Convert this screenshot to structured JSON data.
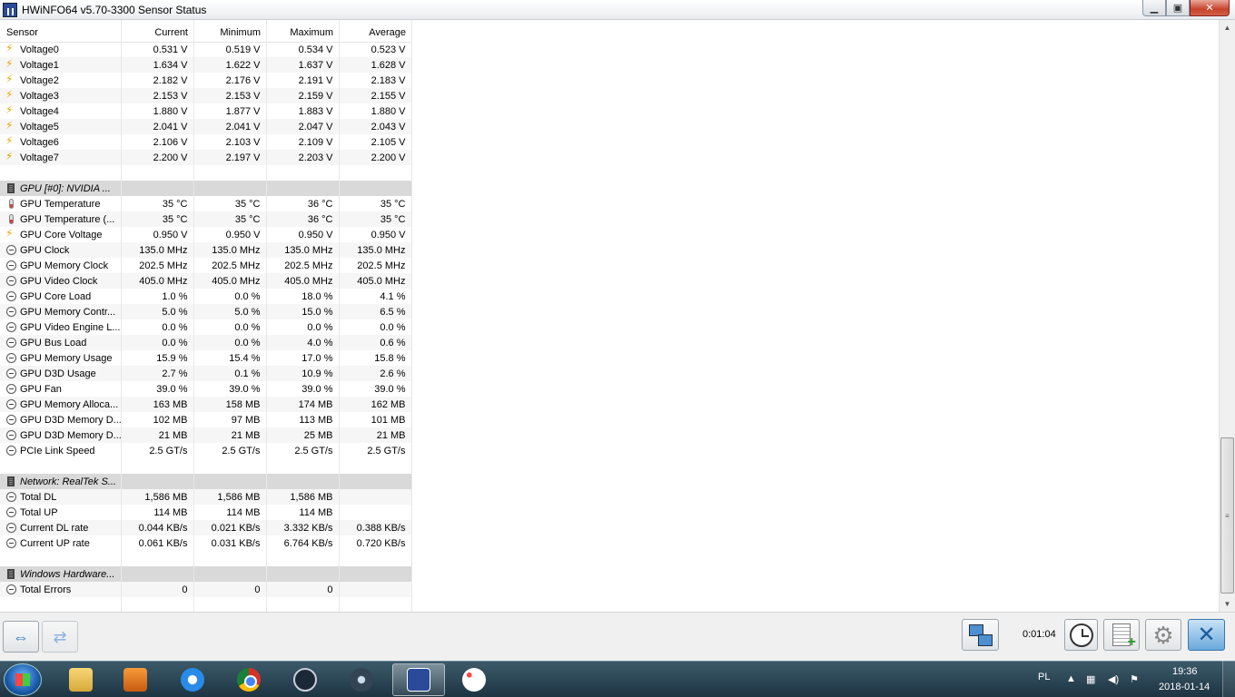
{
  "window": {
    "title": "HWiNFO64 v5.70-3300 Sensor Status"
  },
  "columns": [
    "Sensor",
    "Current",
    "Minimum",
    "Maximum",
    "Average"
  ],
  "rows": [
    {
      "type": "data",
      "icon": "bolt",
      "name": "Voltage0",
      "cur": "0.531 V",
      "min": "0.519 V",
      "max": "0.534 V",
      "avg": "0.523 V"
    },
    {
      "type": "data",
      "icon": "bolt",
      "name": "Voltage1",
      "cur": "1.634 V",
      "min": "1.622 V",
      "max": "1.637 V",
      "avg": "1.628 V"
    },
    {
      "type": "data",
      "icon": "bolt",
      "name": "Voltage2",
      "cur": "2.182 V",
      "min": "2.176 V",
      "max": "2.191 V",
      "avg": "2.183 V"
    },
    {
      "type": "data",
      "icon": "bolt",
      "name": "Voltage3",
      "cur": "2.153 V",
      "min": "2.153 V",
      "max": "2.159 V",
      "avg": "2.155 V"
    },
    {
      "type": "data",
      "icon": "bolt",
      "name": "Voltage4",
      "cur": "1.880 V",
      "min": "1.877 V",
      "max": "1.883 V",
      "avg": "1.880 V"
    },
    {
      "type": "data",
      "icon": "bolt",
      "name": "Voltage5",
      "cur": "2.041 V",
      "min": "2.041 V",
      "max": "2.047 V",
      "avg": "2.043 V"
    },
    {
      "type": "data",
      "icon": "bolt",
      "name": "Voltage6",
      "cur": "2.106 V",
      "min": "2.103 V",
      "max": "2.109 V",
      "avg": "2.105 V"
    },
    {
      "type": "data",
      "icon": "bolt",
      "name": "Voltage7",
      "cur": "2.200 V",
      "min": "2.197 V",
      "max": "2.203 V",
      "avg": "2.200 V"
    },
    {
      "type": "gap"
    },
    {
      "type": "group",
      "name": "GPU [#0]: NVIDIA ..."
    },
    {
      "type": "data",
      "icon": "therm",
      "name": "GPU Temperature",
      "cur": "35 °C",
      "min": "35 °C",
      "max": "36 °C",
      "avg": "35 °C"
    },
    {
      "type": "data",
      "icon": "therm",
      "name": "GPU Temperature (...",
      "cur": "35 °C",
      "min": "35 °C",
      "max": "36 °C",
      "avg": "35 °C"
    },
    {
      "type": "data",
      "icon": "bolt",
      "name": "GPU Core Voltage",
      "cur": "0.950 V",
      "min": "0.950 V",
      "max": "0.950 V",
      "avg": "0.950 V"
    },
    {
      "type": "data",
      "icon": "clock",
      "name": "GPU Clock",
      "cur": "135.0 MHz",
      "min": "135.0 MHz",
      "max": "135.0 MHz",
      "avg": "135.0 MHz"
    },
    {
      "type": "data",
      "icon": "clock",
      "name": "GPU Memory Clock",
      "cur": "202.5 MHz",
      "min": "202.5 MHz",
      "max": "202.5 MHz",
      "avg": "202.5 MHz"
    },
    {
      "type": "data",
      "icon": "clock",
      "name": "GPU Video Clock",
      "cur": "405.0 MHz",
      "min": "405.0 MHz",
      "max": "405.0 MHz",
      "avg": "405.0 MHz"
    },
    {
      "type": "data",
      "icon": "clock",
      "name": "GPU Core Load",
      "cur": "1.0 %",
      "min": "0.0 %",
      "max": "18.0 %",
      "avg": "4.1 %"
    },
    {
      "type": "data",
      "icon": "clock",
      "name": "GPU Memory Contr...",
      "cur": "5.0 %",
      "min": "5.0 %",
      "max": "15.0 %",
      "avg": "6.5 %"
    },
    {
      "type": "data",
      "icon": "clock",
      "name": "GPU Video Engine L...",
      "cur": "0.0 %",
      "min": "0.0 %",
      "max": "0.0 %",
      "avg": "0.0 %"
    },
    {
      "type": "data",
      "icon": "clock",
      "name": "GPU Bus Load",
      "cur": "0.0 %",
      "min": "0.0 %",
      "max": "4.0 %",
      "avg": "0.6 %"
    },
    {
      "type": "data",
      "icon": "clock",
      "name": "GPU Memory Usage",
      "cur": "15.9 %",
      "min": "15.4 %",
      "max": "17.0 %",
      "avg": "15.8 %"
    },
    {
      "type": "data",
      "icon": "clock",
      "name": "GPU D3D Usage",
      "cur": "2.7 %",
      "min": "0.1 %",
      "max": "10.9 %",
      "avg": "2.6 %"
    },
    {
      "type": "data",
      "icon": "clock",
      "name": "GPU Fan",
      "cur": "39.0 %",
      "min": "39.0 %",
      "max": "39.0 %",
      "avg": "39.0 %"
    },
    {
      "type": "data",
      "icon": "clock",
      "name": "GPU Memory Alloca...",
      "cur": "163 MB",
      "min": "158 MB",
      "max": "174 MB",
      "avg": "162 MB"
    },
    {
      "type": "data",
      "icon": "clock",
      "name": "GPU D3D Memory D...",
      "cur": "102 MB",
      "min": "97 MB",
      "max": "113 MB",
      "avg": "101 MB"
    },
    {
      "type": "data",
      "icon": "clock",
      "name": "GPU D3D Memory D...",
      "cur": "21 MB",
      "min": "21 MB",
      "max": "25 MB",
      "avg": "21 MB"
    },
    {
      "type": "data",
      "icon": "clock",
      "name": "PCIe Link Speed",
      "cur": "2.5 GT/s",
      "min": "2.5 GT/s",
      "max": "2.5 GT/s",
      "avg": "2.5 GT/s"
    },
    {
      "type": "gap"
    },
    {
      "type": "group",
      "name": "Network: RealTek S..."
    },
    {
      "type": "data",
      "icon": "clock",
      "name": "Total DL",
      "cur": "1,586 MB",
      "min": "1,586 MB",
      "max": "1,586 MB",
      "avg": ""
    },
    {
      "type": "data",
      "icon": "clock",
      "name": "Total UP",
      "cur": "114 MB",
      "min": "114 MB",
      "max": "114 MB",
      "avg": ""
    },
    {
      "type": "data",
      "icon": "clock",
      "name": "Current DL rate",
      "cur": "0.044 KB/s",
      "min": "0.021 KB/s",
      "max": "3.332 KB/s",
      "avg": "0.388 KB/s"
    },
    {
      "type": "data",
      "icon": "clock",
      "name": "Current UP rate",
      "cur": "0.061 KB/s",
      "min": "0.031 KB/s",
      "max": "6.764 KB/s",
      "avg": "0.720 KB/s"
    },
    {
      "type": "gap"
    },
    {
      "type": "group",
      "name": "Windows Hardware..."
    },
    {
      "type": "data",
      "icon": "clock",
      "name": "Total Errors",
      "cur": "0",
      "min": "0",
      "max": "0",
      "avg": ""
    },
    {
      "type": "gap"
    }
  ],
  "toolbar": {
    "elapsed": "0:01:04"
  },
  "taskbar": {
    "lang": "PL",
    "time": "19:36",
    "date": "2018-01-14"
  }
}
